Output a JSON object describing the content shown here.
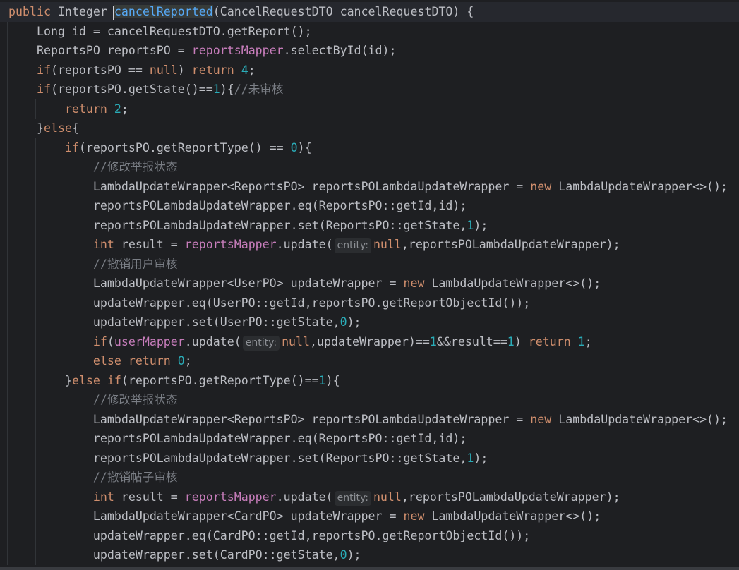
{
  "editor": {
    "current_line": 0,
    "colors": {
      "keyword": "#cf8e6d",
      "text": "#bcbec4",
      "method": "#56a8f5",
      "field": "#c77dbb",
      "number": "#2aacb8",
      "comment": "#7a7e85",
      "background": "#1e1f22"
    },
    "lines": [
      {
        "indent": 0,
        "tokens": [
          [
            "k",
            "public "
          ],
          [
            "t",
            "Integer "
          ],
          [
            "caret",
            ""
          ],
          [
            "m",
            "cancelReported"
          ],
          [
            "t",
            "(CancelRequestDTO cancelRequestDTO) {"
          ]
        ]
      },
      {
        "indent": 1,
        "tokens": [
          [
            "t",
            "Long id = cancelRequestDTO.getReport();"
          ]
        ]
      },
      {
        "indent": 1,
        "tokens": [
          [
            "t",
            "ReportsPO reportsPO = "
          ],
          [
            "f",
            "reportsMapper"
          ],
          [
            "t",
            ".selectById(id);"
          ]
        ]
      },
      {
        "indent": 1,
        "tokens": [
          [
            "k",
            "if"
          ],
          [
            "t",
            "(reportsPO == "
          ],
          [
            "k",
            "null"
          ],
          [
            "t",
            ") "
          ],
          [
            "k",
            "return "
          ],
          [
            "n",
            "4"
          ],
          [
            "t",
            ";"
          ]
        ]
      },
      {
        "indent": 1,
        "tokens": [
          [
            "k",
            "if"
          ],
          [
            "t",
            "(reportsPO.getState()=="
          ],
          [
            "n",
            "1"
          ],
          [
            "t",
            "){"
          ],
          [
            "c",
            "//未审核"
          ]
        ]
      },
      {
        "indent": 2,
        "tokens": [
          [
            "k",
            "return "
          ],
          [
            "n",
            "2"
          ],
          [
            "t",
            ";"
          ]
        ]
      },
      {
        "indent": 1,
        "tokens": [
          [
            "t",
            "}"
          ],
          [
            "k",
            "else"
          ],
          [
            "t",
            "{"
          ]
        ]
      },
      {
        "indent": 2,
        "tokens": [
          [
            "k",
            "if"
          ],
          [
            "t",
            "(reportsPO.getReportType() == "
          ],
          [
            "n",
            "0"
          ],
          [
            "t",
            "){"
          ]
        ]
      },
      {
        "indent": 3,
        "tokens": [
          [
            "c",
            "//修改举报状态"
          ]
        ]
      },
      {
        "indent": 3,
        "tokens": [
          [
            "t",
            "LambdaUpdateWrapper<ReportsPO> reportsPOLambdaUpdateWrapper = "
          ],
          [
            "k",
            "new "
          ],
          [
            "t",
            "LambdaUpdateWrapper<>();"
          ]
        ]
      },
      {
        "indent": 3,
        "tokens": [
          [
            "t",
            "reportsPOLambdaUpdateWrapper.eq(ReportsPO::getId,id);"
          ]
        ]
      },
      {
        "indent": 3,
        "tokens": [
          [
            "t",
            "reportsPOLambdaUpdateWrapper.set(ReportsPO::getState,"
          ],
          [
            "n",
            "1"
          ],
          [
            "t",
            ");"
          ]
        ]
      },
      {
        "indent": 3,
        "tokens": [
          [
            "k",
            "int "
          ],
          [
            "t",
            "result = "
          ],
          [
            "f",
            "reportsMapper"
          ],
          [
            "t",
            ".update("
          ],
          [
            "h",
            "entity:"
          ],
          [
            "k",
            "null"
          ],
          [
            "t",
            ",reportsPOLambdaUpdateWrapper);"
          ]
        ]
      },
      {
        "indent": 3,
        "tokens": [
          [
            "c",
            "//撤销用户审核"
          ]
        ]
      },
      {
        "indent": 3,
        "tokens": [
          [
            "t",
            "LambdaUpdateWrapper<UserPO> updateWrapper = "
          ],
          [
            "k",
            "new "
          ],
          [
            "t",
            "LambdaUpdateWrapper<>();"
          ]
        ]
      },
      {
        "indent": 3,
        "tokens": [
          [
            "t",
            "updateWrapper.eq(UserPO::getId,reportsPO.getReportObjectId());"
          ]
        ]
      },
      {
        "indent": 3,
        "tokens": [
          [
            "t",
            "updateWrapper.set(UserPO::getState,"
          ],
          [
            "n",
            "0"
          ],
          [
            "t",
            ");"
          ]
        ]
      },
      {
        "indent": 3,
        "tokens": [
          [
            "k",
            "if"
          ],
          [
            "t",
            "("
          ],
          [
            "f",
            "userMapper"
          ],
          [
            "t",
            ".update("
          ],
          [
            "h",
            "entity:"
          ],
          [
            "k",
            "null"
          ],
          [
            "t",
            ",updateWrapper)=="
          ],
          [
            "n",
            "1"
          ],
          [
            "t",
            "&&result=="
          ],
          [
            "n",
            "1"
          ],
          [
            "t",
            ") "
          ],
          [
            "k",
            "return "
          ],
          [
            "n",
            "1"
          ],
          [
            "t",
            ";"
          ]
        ]
      },
      {
        "indent": 3,
        "tokens": [
          [
            "k",
            "else return "
          ],
          [
            "n",
            "0"
          ],
          [
            "t",
            ";"
          ]
        ]
      },
      {
        "indent": 2,
        "tokens": [
          [
            "t",
            "}"
          ],
          [
            "k",
            "else if"
          ],
          [
            "t",
            "(reportsPO.getReportType()=="
          ],
          [
            "n",
            "1"
          ],
          [
            "t",
            "){"
          ]
        ]
      },
      {
        "indent": 3,
        "tokens": [
          [
            "c",
            "//修改举报状态"
          ]
        ]
      },
      {
        "indent": 3,
        "tokens": [
          [
            "t",
            "LambdaUpdateWrapper<ReportsPO> reportsPOLambdaUpdateWrapper = "
          ],
          [
            "k",
            "new "
          ],
          [
            "t",
            "LambdaUpdateWrapper<>();"
          ]
        ]
      },
      {
        "indent": 3,
        "tokens": [
          [
            "t",
            "reportsPOLambdaUpdateWrapper.eq(ReportsPO::getId,id);"
          ]
        ]
      },
      {
        "indent": 3,
        "tokens": [
          [
            "t",
            "reportsPOLambdaUpdateWrapper.set(ReportsPO::getState,"
          ],
          [
            "n",
            "1"
          ],
          [
            "t",
            ");"
          ]
        ]
      },
      {
        "indent": 3,
        "tokens": [
          [
            "c",
            "//撤销帖子审核"
          ]
        ]
      },
      {
        "indent": 3,
        "tokens": [
          [
            "k",
            "int "
          ],
          [
            "t",
            "result = "
          ],
          [
            "f",
            "reportsMapper"
          ],
          [
            "t",
            ".update("
          ],
          [
            "h",
            "entity:"
          ],
          [
            "k",
            "null"
          ],
          [
            "t",
            ",reportsPOLambdaUpdateWrapper);"
          ]
        ]
      },
      {
        "indent": 3,
        "tokens": [
          [
            "t",
            "LambdaUpdateWrapper<CardPO> updateWrapper = "
          ],
          [
            "k",
            "new "
          ],
          [
            "t",
            "LambdaUpdateWrapper<>();"
          ]
        ]
      },
      {
        "indent": 3,
        "tokens": [
          [
            "t",
            "updateWrapper.eq(CardPO::getId,reportsPO.getReportObjectId());"
          ]
        ]
      },
      {
        "indent": 3,
        "tokens": [
          [
            "t",
            "updateWrapper.set(CardPO::getState,"
          ],
          [
            "n",
            "0"
          ],
          [
            "t",
            ");"
          ]
        ]
      }
    ]
  }
}
